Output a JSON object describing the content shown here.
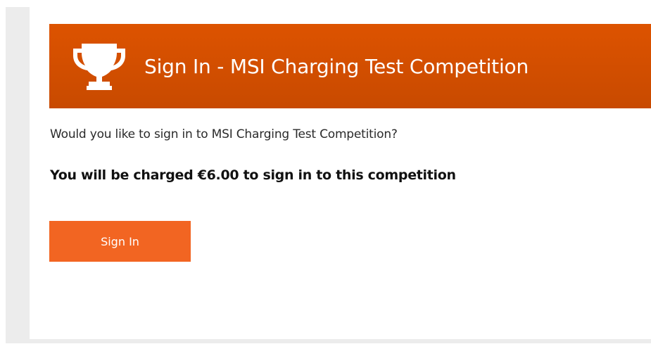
{
  "header": {
    "icon": "trophy-icon",
    "title": "Sign In - MSI Charging Test Competition"
  },
  "content": {
    "question": "Would you like to sign in to MSI Charging Test Competition?",
    "charge_note": "You will be charged €6.00 to sign in to this competition"
  },
  "actions": {
    "sign_in_label": "Sign In"
  },
  "colors": {
    "header_top": "#dd5300",
    "header_bottom": "#c84a00",
    "button": "#f26522",
    "frame": "#ececec"
  }
}
